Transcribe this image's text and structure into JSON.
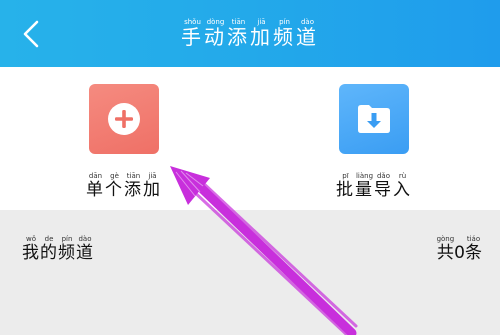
{
  "header": {
    "title": [
      {
        "char": "手",
        "pinyin": "shǒu"
      },
      {
        "char": "动",
        "pinyin": "dòng"
      },
      {
        "char": "添",
        "pinyin": "tiān"
      },
      {
        "char": "加",
        "pinyin": "jiā"
      },
      {
        "char": "频",
        "pinyin": "pín"
      },
      {
        "char": "道",
        "pinyin": "dào"
      }
    ],
    "back_icon": "chevron-left-icon"
  },
  "actions": {
    "single": {
      "icon": "plus-circle-icon",
      "label": [
        {
          "char": "单",
          "pinyin": "dān"
        },
        {
          "char": "个",
          "pinyin": "gè"
        },
        {
          "char": "添",
          "pinyin": "tiān"
        },
        {
          "char": "加",
          "pinyin": "jiā"
        }
      ]
    },
    "batch": {
      "icon": "folder-download-icon",
      "label": [
        {
          "char": "批",
          "pinyin": "pī"
        },
        {
          "char": "量",
          "pinyin": "liàng"
        },
        {
          "char": "导",
          "pinyin": "dǎo"
        },
        {
          "char": "入",
          "pinyin": "rù"
        }
      ]
    }
  },
  "channels": {
    "title": [
      {
        "char": "我",
        "pinyin": "wǒ"
      },
      {
        "char": "的",
        "pinyin": "de"
      },
      {
        "char": "频",
        "pinyin": "pín"
      },
      {
        "char": "道",
        "pinyin": "dào"
      }
    ],
    "count": [
      {
        "char": "共",
        "pinyin": "gòng"
      },
      {
        "char": "0",
        "pinyin": ""
      },
      {
        "char": "条",
        "pinyin": "tiáo"
      }
    ]
  },
  "colors": {
    "header": "#23a9ea",
    "single_tile": "#ef7066",
    "batch_tile": "#3a9df3",
    "annotation_arrow": "#c82fdc"
  }
}
